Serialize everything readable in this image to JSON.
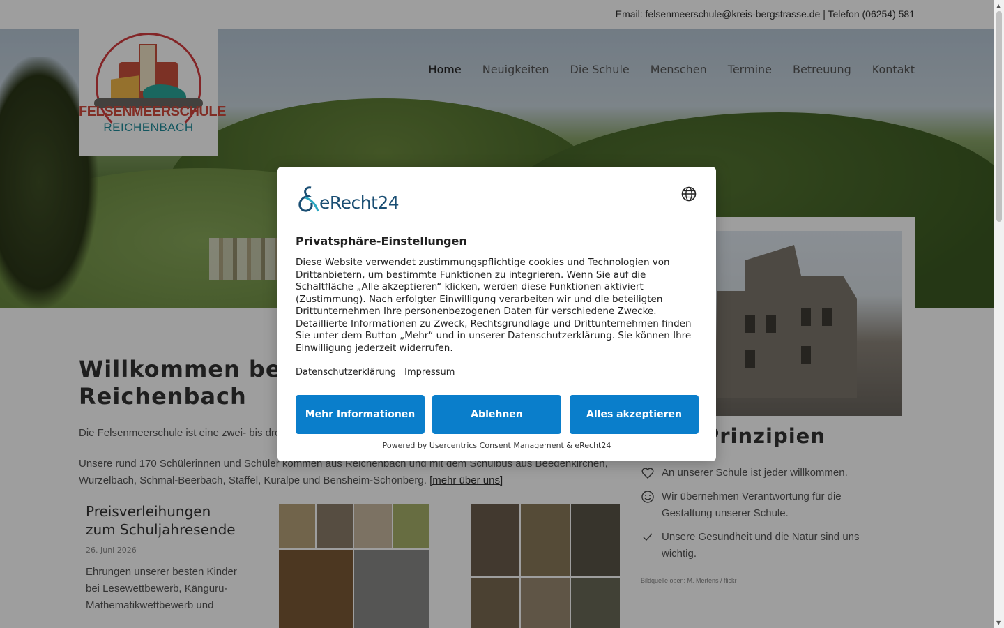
{
  "topbar": {
    "contact": "Email: felsenmeerschule@kreis-bergstrasse.de | Telefon (06254) 581"
  },
  "logo": {
    "line1": "FELSENMEERSCHULE",
    "line2": "REICHENBACH"
  },
  "nav": {
    "items": [
      "Home",
      "Neuigkeiten",
      "Die Schule",
      "Menschen",
      "Termine",
      "Betreuung",
      "Kontakt"
    ],
    "active": "Home"
  },
  "main": {
    "welcome": "Willkommen bei der Felsenmeerschule Reichenbach",
    "intro1": "Die Felsenmeerschule ist eine zwei- bis dreizügige Grundschule mit Betreuung am Nachmittag.",
    "intro2": "Unsere rund 170 Schülerinnen und Schüler kommen aus Reichenbach und mit dem Schulbus aus Beedenkirchen, Wurzelbach, Schmal-Beerbach, Staffel, Kuralpe und Bensheim-Schönberg.",
    "more_link": "[mehr über uns]"
  },
  "cards": [
    {
      "title": "Preisverleihungen zum Schuljahresende",
      "date": "26. Juni 2026",
      "text": "Ehrungen unserer besten Kinder bei Lesewettbewerb, Känguru-Mathematikwettbewerb und"
    }
  ],
  "sidebar": {
    "principles_title": "Prinzipien",
    "principles": [
      {
        "icon": "heart-icon",
        "text": "An unserer Schule ist jeder willkommen."
      },
      {
        "icon": "smiley-icon",
        "text": "Wir übernehmen Verantwortung für die Gestaltung unserer Schule."
      },
      {
        "icon": "checkmark-icon",
        "text": "Unsere Gesundheit und die Natur sind uns wichtig."
      }
    ],
    "credit": "Bildquelle oben: M. Mertens / flickr"
  },
  "consent": {
    "brand": "eRecht24",
    "title": "Privatsphäre-Einstellungen",
    "text": "Diese Website verwendet zustimmungspflichtige cookies und Technologien von Drittanbietern, um bestimmte Funktionen zu integrieren. Wenn Sie auf die Schaltfläche „Alle akzeptieren“ klicken, werden diese Funktionen aktiviert (Zustimmung). Nach erfolgter Einwilligung verarbeiten wir und die beteiligten Drittunternehmen Ihre personenbezogenen Daten für verschiedene Zwecke. Detaillierte Informationen zu Zweck, Rechtsgrundlage und Drittunternehmen finden Sie unter dem Button „Mehr“ und in unserer Datenschutzerklärung. Sie können Ihre Einwilligung jederzeit widerrufen.",
    "link_privacy": "Datenschutzerklärung",
    "link_imprint": "Impressum",
    "btn_more": "Mehr Informationen",
    "btn_deny": "Ablehnen",
    "btn_accept": "Alles akzeptieren",
    "powered": "Powered by Usercentrics Consent Management & eRecht24"
  },
  "colors": {
    "accent": "#0a7ecb",
    "brand_navy": "#1a4e73",
    "brand_teal": "#1f8c9a",
    "logo_red": "#d04a3c"
  }
}
